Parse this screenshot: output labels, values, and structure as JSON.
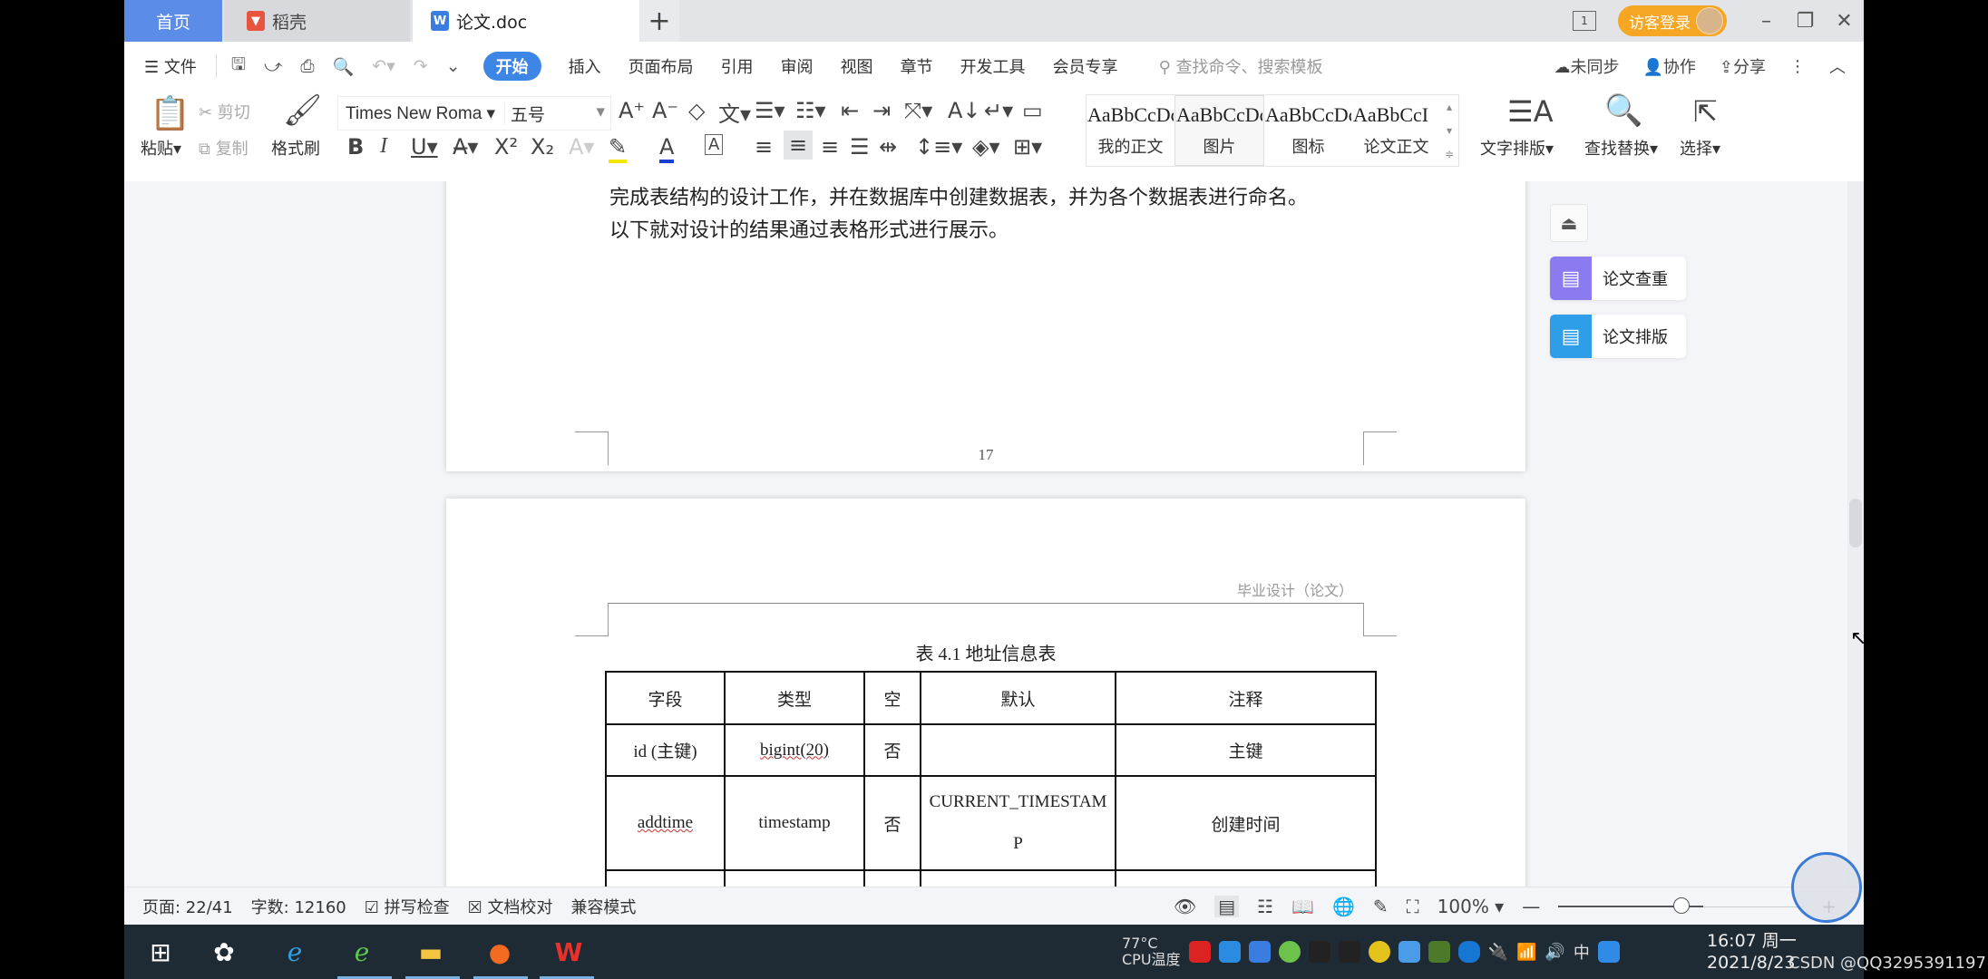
{
  "tabs": [
    {
      "label": "首页",
      "active": false
    },
    {
      "label": "稻壳",
      "icon": "daoke-icon"
    },
    {
      "label": "论文.doc",
      "icon": "wps-writer-icon",
      "active": true
    }
  ],
  "window": {
    "page_indicator": "1",
    "login_label": "访客登录"
  },
  "menu": {
    "file": "文件",
    "items": [
      "开始",
      "插入",
      "页面布局",
      "引用",
      "审阅",
      "视图",
      "章节",
      "开发工具",
      "会员专享"
    ],
    "active": "开始",
    "search_placeholder": "查找命令、搜索模板",
    "sync": "未同步",
    "collab": "协作",
    "share": "分享"
  },
  "ribbon": {
    "paste": "粘贴",
    "cut": "剪切",
    "copy": "复制",
    "format_painter": "格式刷",
    "font_name": "Times New Roma",
    "font_size": "五号",
    "styles": [
      {
        "preview": "AaBbCcDc",
        "label": "我的正文"
      },
      {
        "preview": "AaBbCcDc",
        "label": "图片",
        "selected": true
      },
      {
        "preview": "AaBbCcDc",
        "label": "图标"
      },
      {
        "preview": "AaBbCcI",
        "label": "论文正文"
      }
    ],
    "text_layout": "文字排版",
    "find_replace": "查找替换",
    "select": "选择",
    "highlight_color": "#f5e600",
    "font_color": "#1a3fd1"
  },
  "document": {
    "line1": "完成表结构的设计工作，并在数据库中创建数据表，并为各个数据表进行命名。",
    "line2": "以下就对设计的结果通过表格形式进行展示。",
    "page_number": "17",
    "header": "毕业设计（论文）",
    "table_caption": "表 4.1  地址信息表",
    "table": {
      "headers": [
        "字段",
        "类型",
        "空",
        "默认",
        "注释"
      ],
      "rows": [
        [
          "id (主键)",
          "bigint(20)",
          "否",
          "",
          "主键"
        ],
        [
          "addtime",
          "timestamp",
          "否",
          "CURRENT_TIMESTAMP",
          "创建时间"
        ]
      ]
    }
  },
  "side_panel": {
    "check": "论文查重",
    "layout": "论文排版"
  },
  "statusbar": {
    "page": "页面: 22/41",
    "words": "字数: 12160",
    "spell": "拼写检查",
    "proof": "文档校对",
    "compat": "兼容模式",
    "zoom": "100%",
    "zoom_fraction": 0.5
  },
  "taskbar": {
    "cpu_temp": "77°C",
    "cpu_label": "CPU温度",
    "ime": "中",
    "time": "16:07 周一",
    "date": "2021/8/23",
    "watermark": "CSDN @QQ3295391197"
  }
}
